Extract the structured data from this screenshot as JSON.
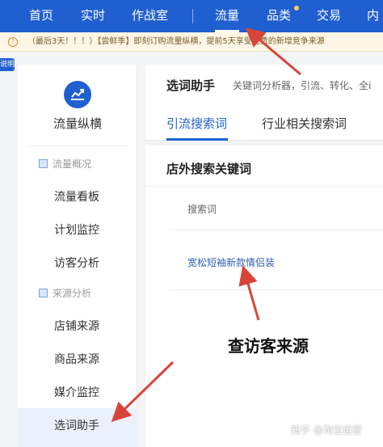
{
  "topnav": {
    "items": [
      {
        "label": "首页"
      },
      {
        "label": "实时"
      },
      {
        "label": "作战室"
      },
      {
        "label": "流量"
      },
      {
        "label": "品类"
      },
      {
        "label": "交易"
      },
      {
        "label": "内"
      }
    ],
    "active_index": 3,
    "bg_color": "#1f5fd0"
  },
  "notice": {
    "icon": "info-icon",
    "text": "（最后3天！！！）【尝鲜季】即刻订购流量纵横，提前5天享受免费的新增竞争来源"
  },
  "edge_tag": "说明",
  "sidebar": {
    "logo_icon": "chart-icon",
    "title": "流量纵横",
    "groups": [
      {
        "label": "流量概况",
        "items": [
          "流量看板",
          "计划监控",
          "访客分析"
        ]
      },
      {
        "label": "来源分析",
        "items": [
          "店铺来源",
          "商品来源",
          "媒介监控",
          "选词助手"
        ]
      }
    ],
    "active_item": "选词助手"
  },
  "main": {
    "title": "选词助手",
    "subtitle": "关键词分析器，引流、转化、全i",
    "tabs": [
      "引流搜索词",
      "行业相关搜索词"
    ],
    "active_tab": 0,
    "section_title": "店外搜索关键词",
    "column_header": "搜索词",
    "rows": [
      "宽松短袖新款情侣装"
    ]
  },
  "annotation": {
    "text": "查访客来源",
    "arrow_color": "#d9443a"
  },
  "watermark": "知乎 @淘宝运营"
}
